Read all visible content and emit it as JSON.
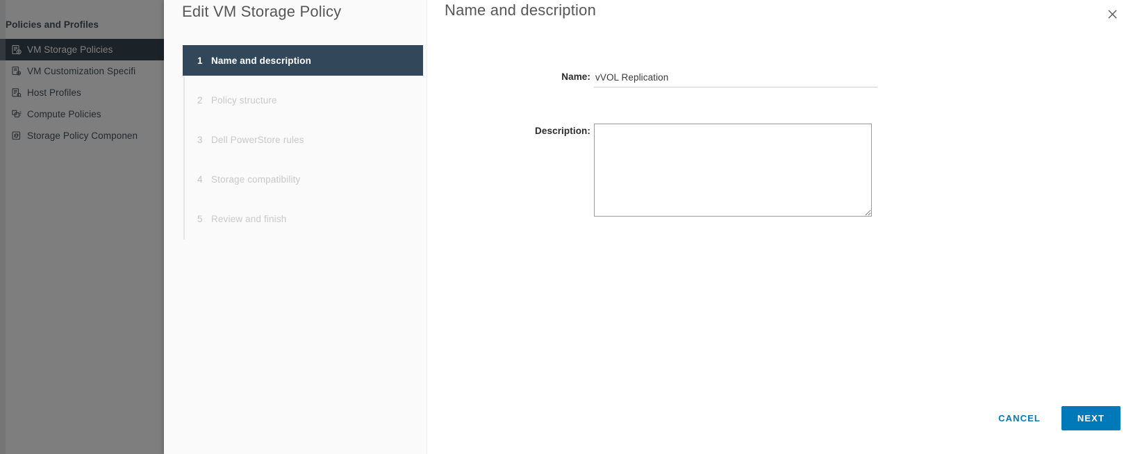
{
  "background_app": {
    "sidebar": {
      "header": "Policies and Profiles",
      "items": [
        {
          "label": "VM Storage Policies",
          "icon": "vm-storage-policy-icon",
          "active": true
        },
        {
          "label": "VM Customization Specifi",
          "icon": "vm-customization-icon",
          "active": false
        },
        {
          "label": "Host Profiles",
          "icon": "host-profile-icon",
          "active": false
        },
        {
          "label": "Compute Policies",
          "icon": "compute-policy-icon",
          "active": false
        },
        {
          "label": "Storage Policy Componen",
          "icon": "storage-policy-component-icon",
          "active": false
        }
      ]
    }
  },
  "wizard": {
    "title": "Edit VM Storage Policy",
    "close_icon": "close-icon",
    "steps": [
      {
        "number": "1",
        "label": "Name and description",
        "current": true
      },
      {
        "number": "2",
        "label": "Policy structure",
        "current": false
      },
      {
        "number": "3",
        "label": "Dell PowerStore rules",
        "current": false
      },
      {
        "number": "4",
        "label": "Storage compatibility",
        "current": false
      },
      {
        "number": "5",
        "label": "Review and finish",
        "current": false
      }
    ],
    "pane": {
      "title": "Name and description",
      "name": {
        "label": "Name:",
        "value": "vVOL Replication",
        "placeholder": ""
      },
      "description": {
        "label": "Description:",
        "value": "",
        "placeholder": ""
      }
    },
    "footer": {
      "cancel_label": "CANCEL",
      "next_label": "NEXT"
    }
  },
  "colors": {
    "accent_blue": "#0079b8",
    "active_step_bg": "#32485a",
    "active_nav_bg": "#0b1c28",
    "nav_panel_bg": "#fafafa",
    "scrim": "rgba(40,40,40,0.60)"
  }
}
